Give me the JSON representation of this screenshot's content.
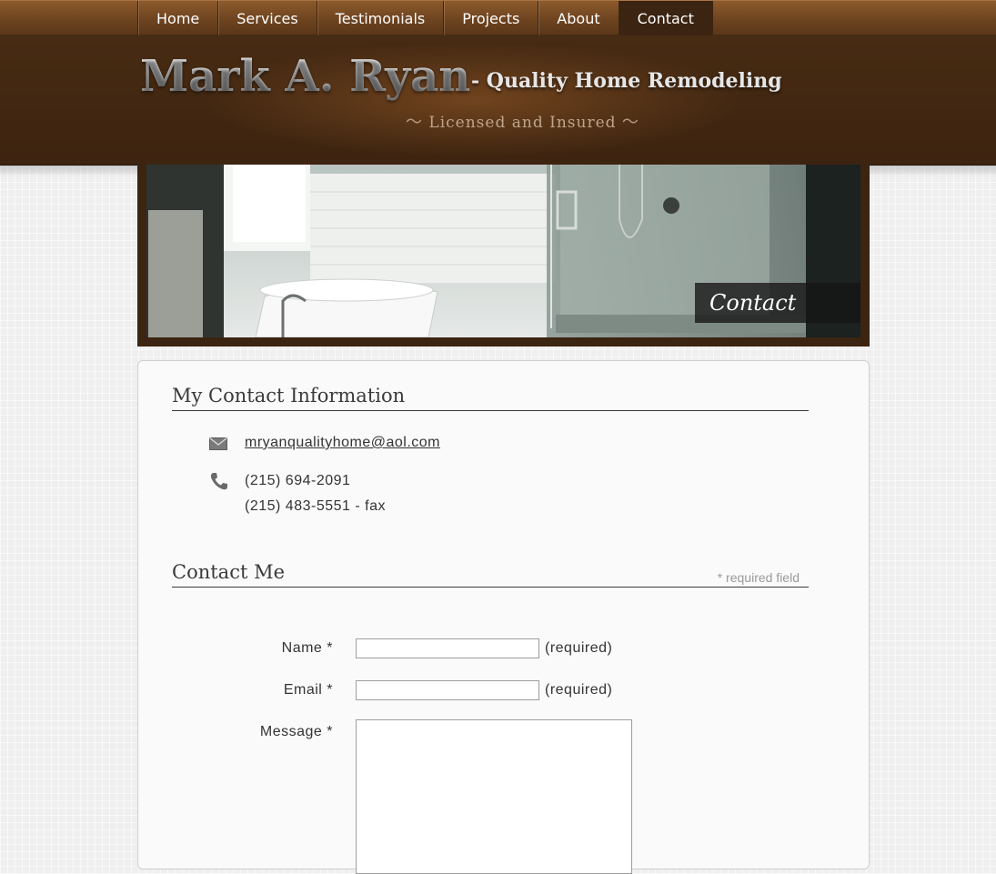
{
  "nav": {
    "items": [
      {
        "label": "Home"
      },
      {
        "label": "Services"
      },
      {
        "label": "Testimonials"
      },
      {
        "label": "Projects"
      },
      {
        "label": "About"
      },
      {
        "label": "Contact",
        "active": true
      }
    ]
  },
  "brand": {
    "name": "Mark A. Ryan",
    "tagline": "- Quality Home Remodeling",
    "sub": "Licensed and Insured"
  },
  "hero": {
    "caption": "Contact"
  },
  "contact_info": {
    "title": "My Contact Information",
    "email": "mryanqualityhome@aol.com",
    "phone": "(215) 694-2091",
    "fax": "(215) 483-5551 - fax"
  },
  "contact_form": {
    "title": "Contact Me",
    "required_note": "* required field",
    "name_label": "Name *",
    "email_label": "Email *",
    "message_label": "Message *",
    "required_suffix": "(required)",
    "name_value": "",
    "email_value": "",
    "message_value": ""
  },
  "colors": {
    "header_brown": "#3d2410",
    "nav_brown": "#6e4420",
    "background": "#efefef"
  },
  "icons": {
    "email": "envelope-icon",
    "phone": "telephone-icon"
  }
}
